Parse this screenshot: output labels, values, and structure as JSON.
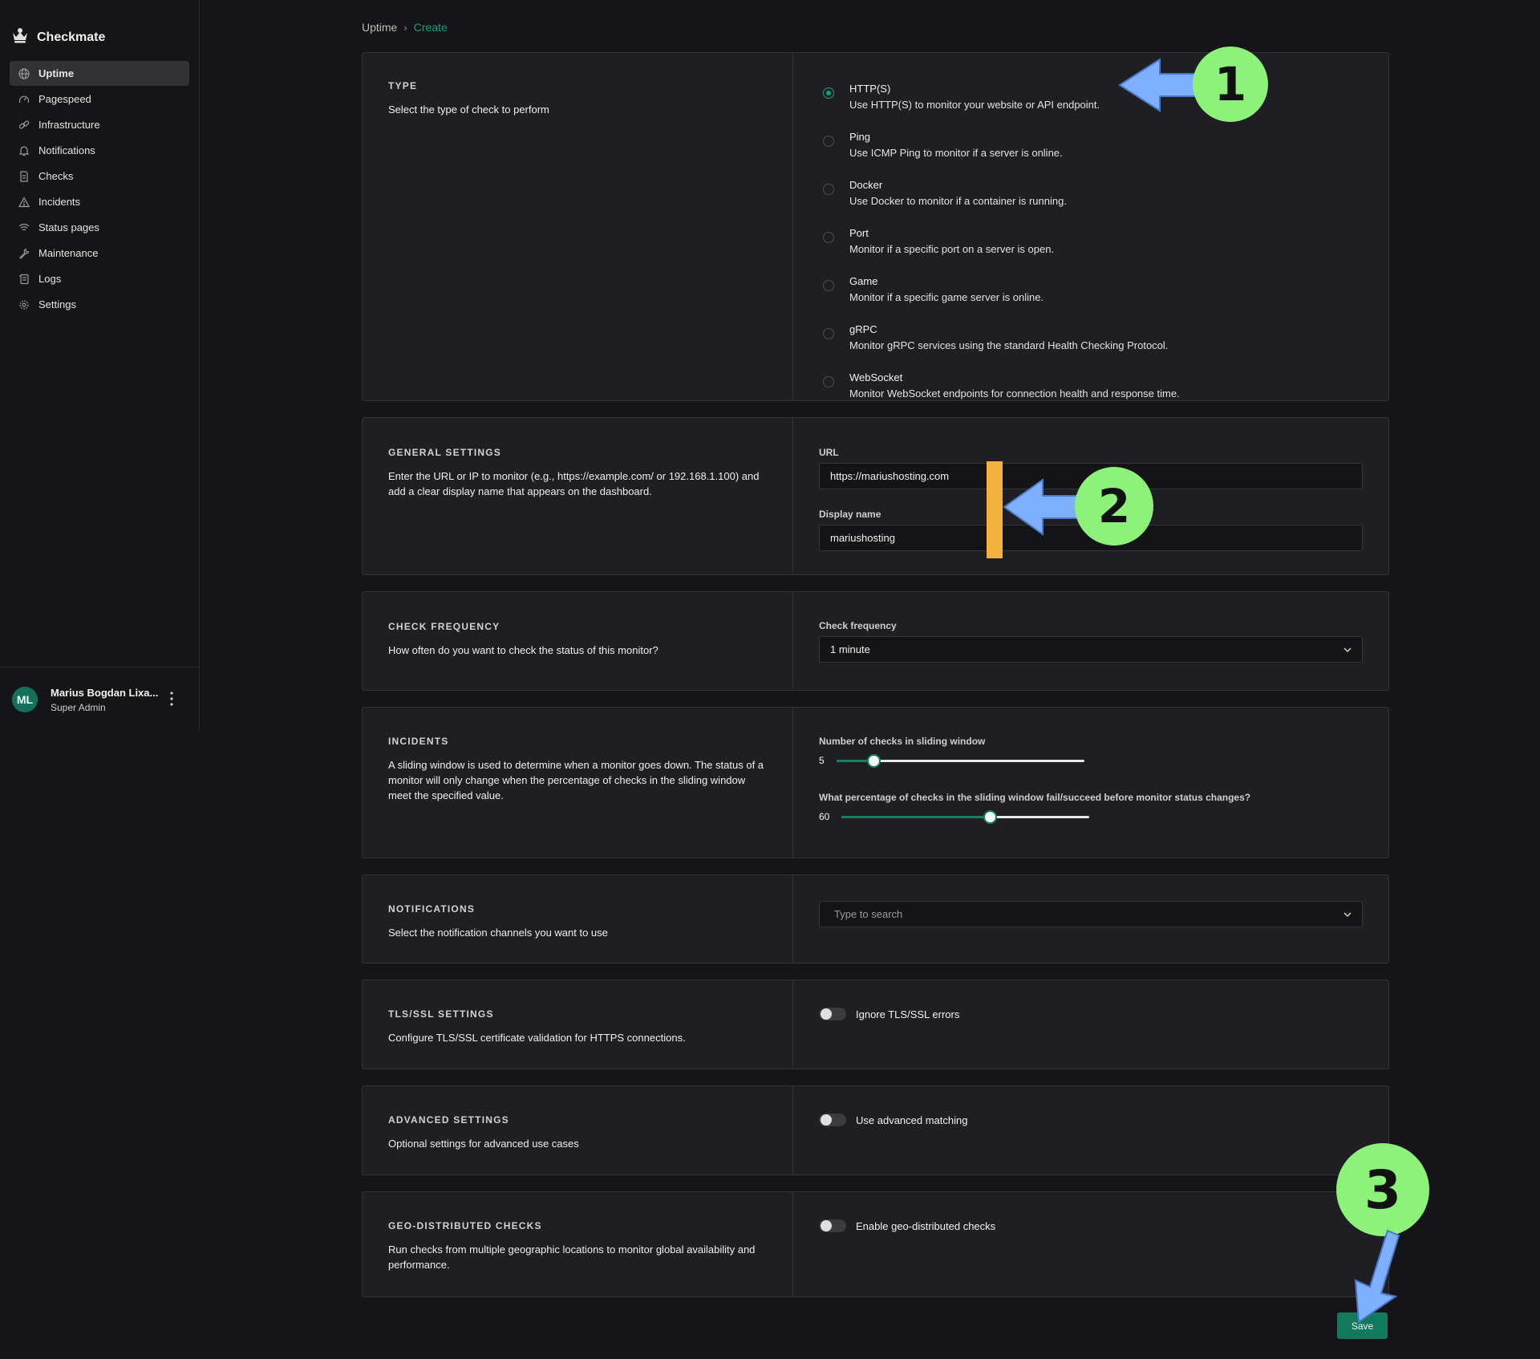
{
  "app": {
    "name": "Checkmate"
  },
  "sidebar": {
    "items": [
      {
        "label": "Uptime",
        "icon": "globe-icon",
        "active": true
      },
      {
        "label": "Pagespeed",
        "icon": "gauge-icon"
      },
      {
        "label": "Infrastructure",
        "icon": "link-icon"
      },
      {
        "label": "Notifications",
        "icon": "bell-icon"
      },
      {
        "label": "Checks",
        "icon": "document-icon"
      },
      {
        "label": "Incidents",
        "icon": "warning-icon"
      },
      {
        "label": "Status pages",
        "icon": "signal-icon"
      },
      {
        "label": "Maintenance",
        "icon": "wrench-icon"
      },
      {
        "label": "Logs",
        "icon": "scroll-icon"
      },
      {
        "label": "Settings",
        "icon": "gear-icon"
      }
    ],
    "user": {
      "initials": "ML",
      "name": "Marius Bogdan Lixa...",
      "role": "Super Admin"
    }
  },
  "breadcrumb": {
    "parent": "Uptime",
    "current": "Create"
  },
  "type_section": {
    "title": "TYPE",
    "description": "Select the type of check to perform",
    "options": [
      {
        "label": "HTTP(S)",
        "desc": "Use HTTP(S) to monitor your website or API endpoint.",
        "checked": true
      },
      {
        "label": "Ping",
        "desc": "Use ICMP Ping to monitor if a server is online."
      },
      {
        "label": "Docker",
        "desc": "Use Docker to monitor if a container is running."
      },
      {
        "label": "Port",
        "desc": "Monitor if a specific port on a server is open."
      },
      {
        "label": "Game",
        "desc": "Monitor if a specific game server is online."
      },
      {
        "label": "gRPC",
        "desc": "Monitor gRPC services using the standard Health Checking Protocol."
      },
      {
        "label": "WebSocket",
        "desc": "Monitor WebSocket endpoints for connection health and response time."
      }
    ]
  },
  "general": {
    "title": "GENERAL SETTINGS",
    "description": "Enter the URL or IP to monitor (e.g., https://example.com/ or 192.168.1.100) and add a clear display name that appears on the dashboard.",
    "url_label": "URL",
    "url_value": "https://mariushosting.com",
    "display_name_label": "Display name",
    "display_name_value": "mariushosting"
  },
  "frequency": {
    "title": "CHECK FREQUENCY",
    "description": "How often do you want to check the status of this monitor?",
    "label": "Check frequency",
    "value": "1 minute"
  },
  "incidents": {
    "title": "INCIDENTS",
    "description": "A sliding window is used to determine when a monitor goes down. The status of a monitor will only change when the percentage of checks in the sliding window meet the specified value.",
    "window_label": "Number of checks in sliding window",
    "window_value": "5",
    "window_fraction": 0.15,
    "percent_label": "What percentage of checks in the sliding window fail/succeed before monitor status changes?",
    "percent_value": "60",
    "percent_fraction": 0.6
  },
  "notifications": {
    "title": "NOTIFICATIONS",
    "description": "Select the notification channels you want to use",
    "placeholder": "Type to search"
  },
  "tls": {
    "title": "TLS/SSL SETTINGS",
    "description": "Configure TLS/SSL certificate validation for HTTPS connections.",
    "toggle_label": "Ignore TLS/SSL errors"
  },
  "advanced": {
    "title": "ADVANCED SETTINGS",
    "description": "Optional settings for advanced use cases",
    "toggle_label": "Use advanced matching"
  },
  "geo": {
    "title": "GEO-DISTRIBUTED CHECKS",
    "description": "Run checks from multiple geographic locations to monitor global availability and performance.",
    "toggle_label": "Enable geo-distributed checks"
  },
  "actions": {
    "save_label": "Save"
  },
  "annotations": {
    "badge_1": "1",
    "badge_2": "2",
    "badge_3": "3",
    "badge_color": "#8df27a",
    "arrow_color": "#7fb0ff",
    "marker_color": "#f6b13c"
  },
  "colors": {
    "accent": "#13a07d",
    "background": "#151518",
    "card": "#1f1f23"
  }
}
